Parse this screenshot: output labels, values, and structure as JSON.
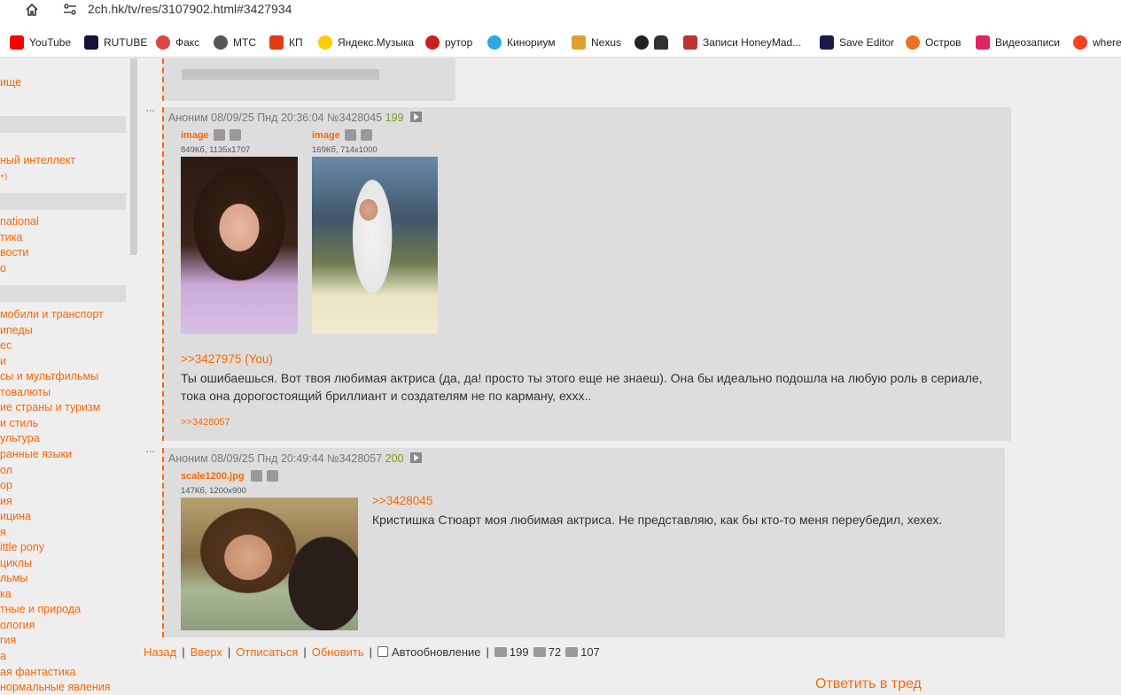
{
  "browser": {
    "url": "2ch.hk/tv/res/3107902.html#3427934",
    "bookmarks": [
      {
        "label": "YouTube",
        "color": "#ff0000"
      },
      {
        "label": "RUTUBE",
        "color": "#14123a"
      },
      {
        "label": "Факс",
        "color": "#d44"
      },
      {
        "label": "МТС",
        "color": "#555"
      },
      {
        "label": "КП",
        "color": "#e03a17"
      },
      {
        "label": "Яндекс.Музыка",
        "color": "#ffcc00"
      },
      {
        "label": "рутор",
        "color": "#c8201d"
      },
      {
        "label": "Кинориум",
        "color": "#2aa9e0"
      },
      {
        "label": "Nexus",
        "color": "#e0a030"
      },
      {
        "label": "",
        "color": "#222"
      },
      {
        "label": "",
        "color": "#333"
      },
      {
        "label": "Записи HoneyMad...",
        "color": "#b33"
      },
      {
        "label": "Save Editor",
        "color": "#1a1a4a"
      },
      {
        "label": "Остров",
        "color": "#f07020"
      },
      {
        "label": "Видеозаписи",
        "color": "#e0245e"
      },
      {
        "label": "where",
        "color": "#fc3f1d"
      }
    ]
  },
  "sidebar": {
    "items": [
      {
        "label": "ище"
      },
      {
        "label": "ный интеллект"
      },
      {
        "label": "+)"
      },
      {
        "label": "national"
      },
      {
        "label": "тика"
      },
      {
        "label": "вости"
      },
      {
        "label": "о"
      },
      {
        "label": "мобили и транспорт"
      },
      {
        "label": "ипеды"
      },
      {
        "label": "ес"
      },
      {
        "label": "и"
      },
      {
        "label": "сы и мультфильмы"
      },
      {
        "label": "товалюты"
      },
      {
        "label": "ие страны и туризм"
      },
      {
        "label": "и стиль"
      },
      {
        "label": "ультура"
      },
      {
        "label": "ранные языки"
      },
      {
        "label": "ол"
      },
      {
        "label": "ор"
      },
      {
        "label": "ия"
      },
      {
        "label": "ицина"
      },
      {
        "label": "я"
      },
      {
        "label": "ittle pony"
      },
      {
        "label": "циклы"
      },
      {
        "label": "льмы"
      },
      {
        "label": "ка"
      },
      {
        "label": "тные и природа"
      },
      {
        "label": "ология"
      },
      {
        "label": "гия"
      },
      {
        "label": "а"
      },
      {
        "label": "ая фантастика"
      },
      {
        "label": "нормальные явления"
      }
    ]
  },
  "posts": [
    {
      "author": "Аноним",
      "date": "08/09/25 Пнд 20:36:04",
      "number": "№3428045",
      "index": "199",
      "files": [
        {
          "name": "image",
          "meta": "849Кб, 1135x1707"
        },
        {
          "name": "image",
          "meta": "169Кб, 714x1000"
        }
      ],
      "reply_to": ">>3427975 (You)",
      "text": "Ты ошибаешься. Вот твоя любимая актриса (да, да! просто ты этого еще не знаеш). Она бы идеально подошла на любую роль в сериале, тока она дорогостоящий бриллиант и создателям не по карману, ехxx..",
      "backlink": ">>3428057"
    },
    {
      "author": "Аноним",
      "date": "08/09/25 Пнд 20:49:44",
      "number": "№3428057",
      "index": "200",
      "files": [
        {
          "name": "scale1200.jpg",
          "meta": "147Кб, 1200x900"
        }
      ],
      "reply_to": ">>3428045",
      "text": "Кристишка Стюарт моя любимая актриса. Не представляю, как бы кто-то меня переубедил, хехех."
    }
  ],
  "thread_nav": {
    "back": "Назад",
    "top": "Вверх",
    "unsubscribe": "Отписаться",
    "refresh": "Обновить",
    "autorefresh": "Автообновление",
    "posts_count": "199",
    "files_count": "72",
    "posters_count": "107"
  },
  "reply_in_thread": "Ответить в тред"
}
